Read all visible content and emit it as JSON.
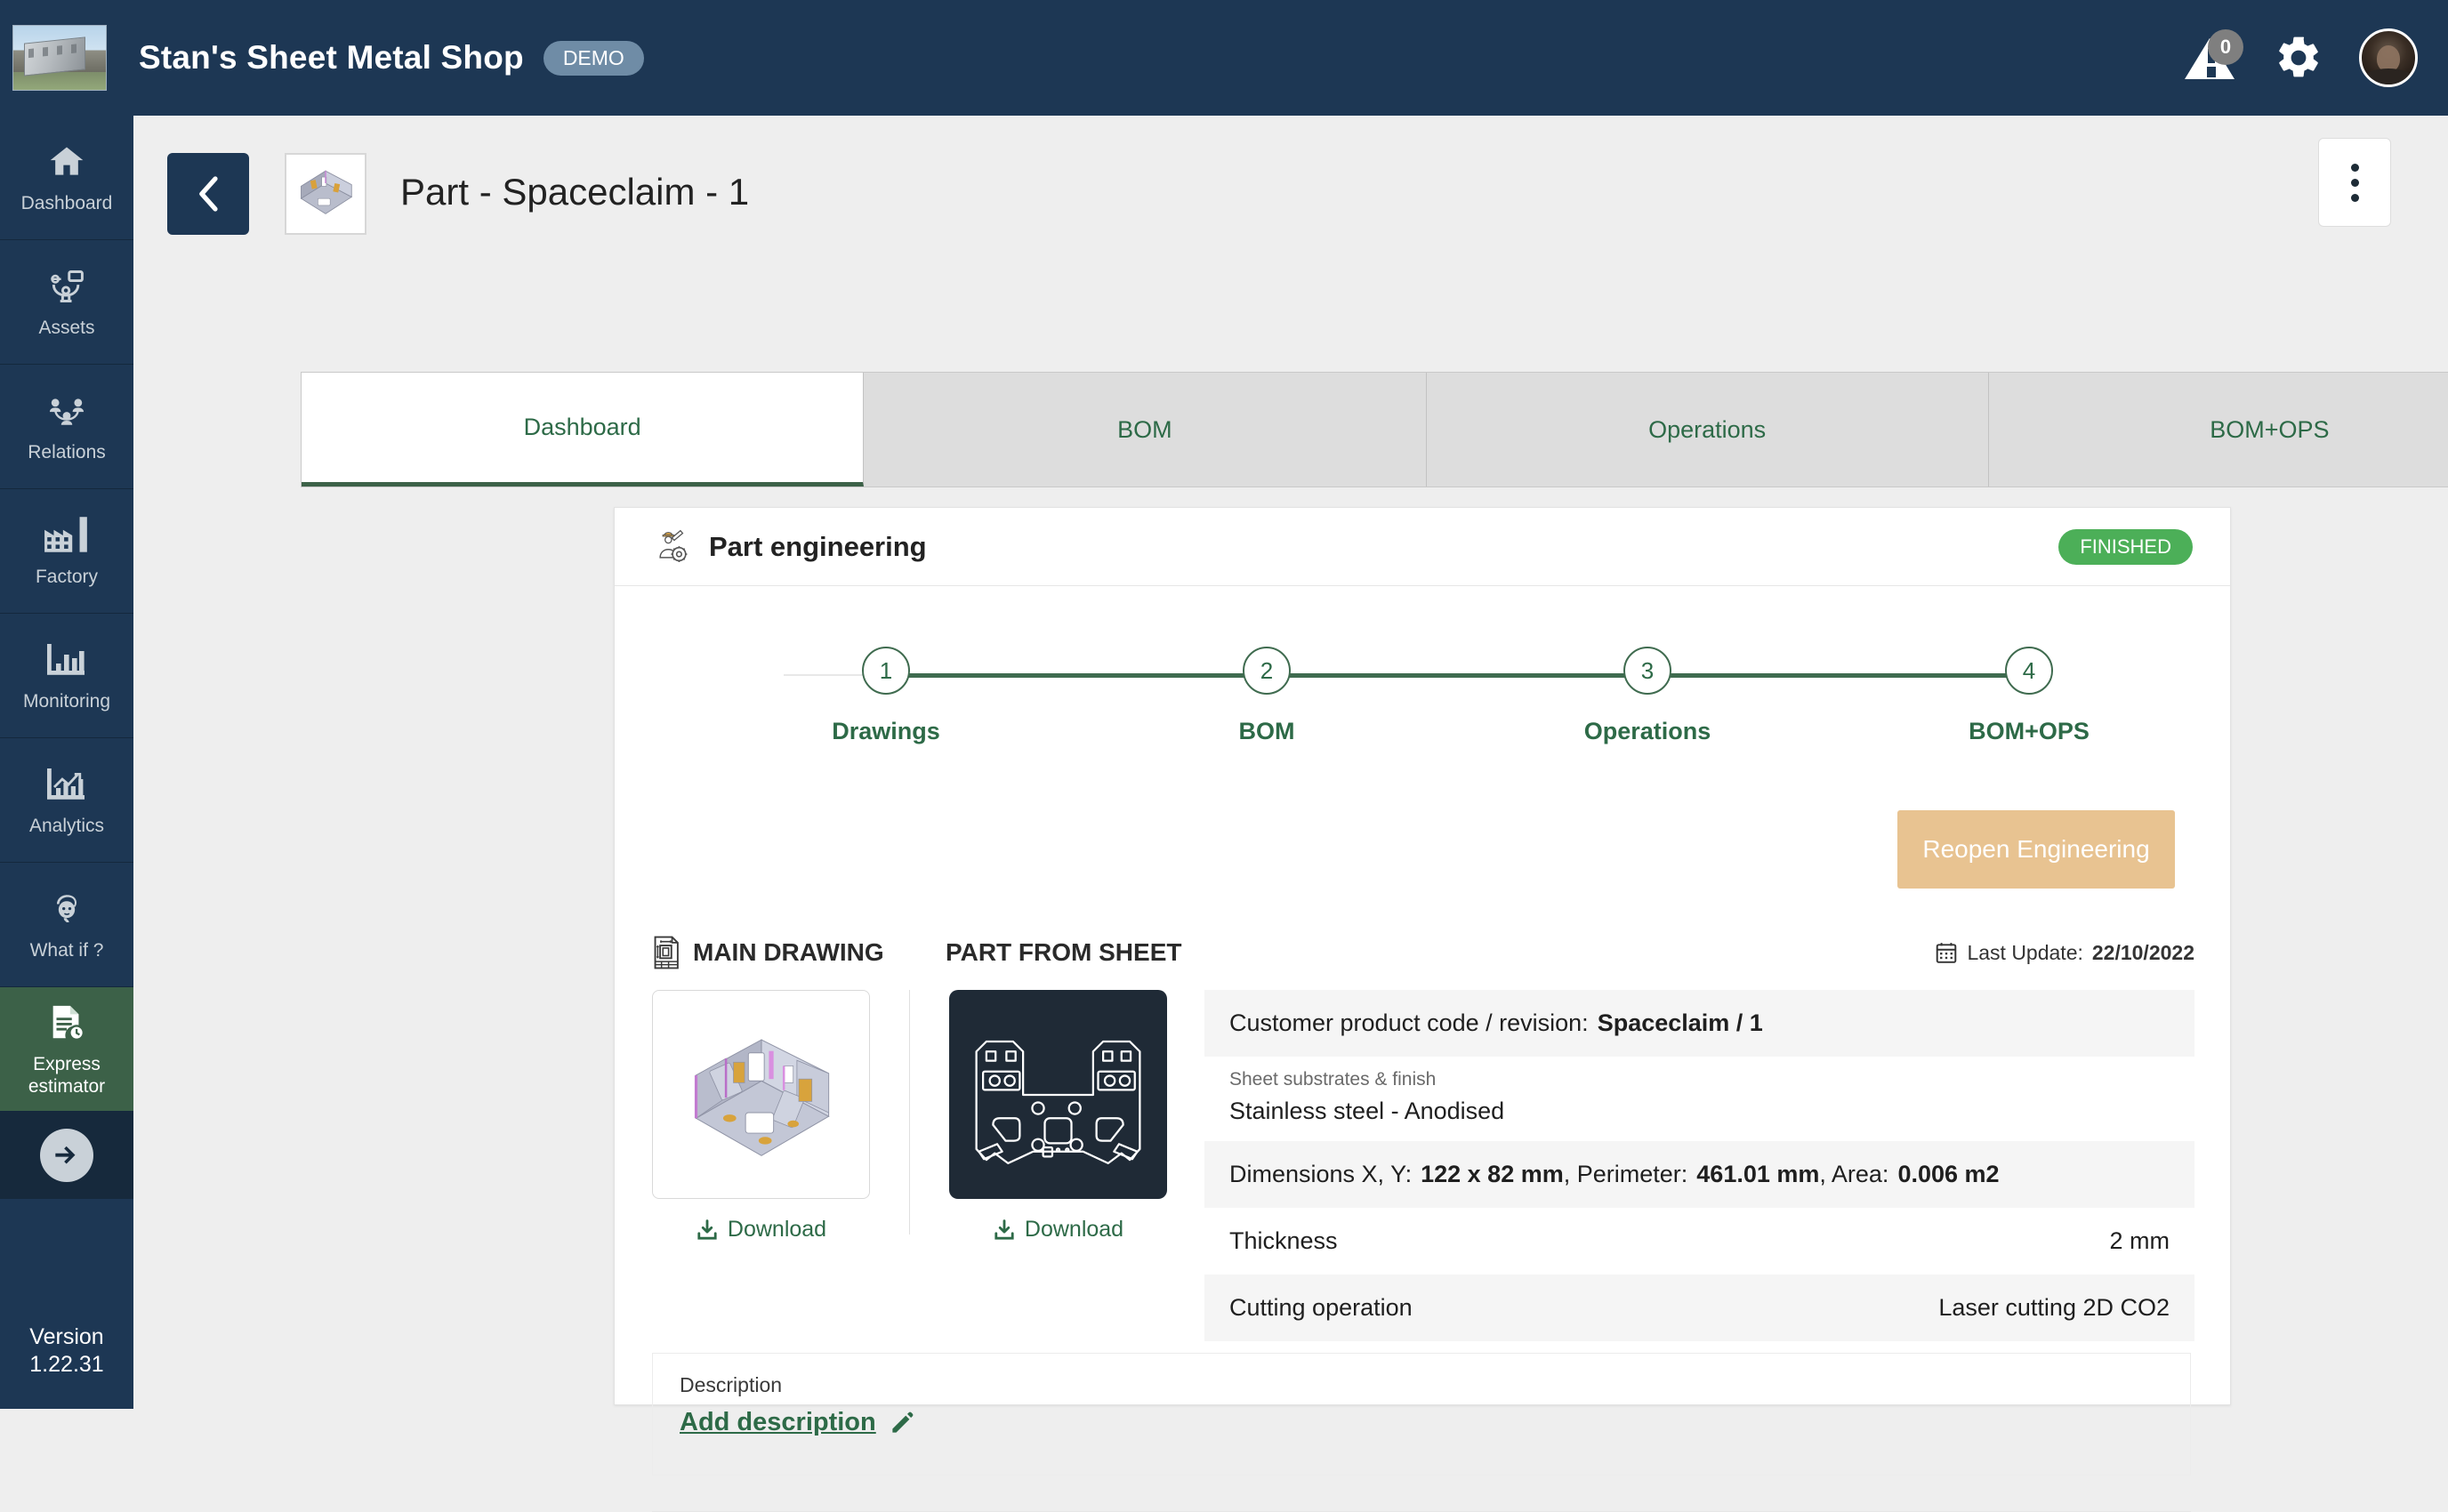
{
  "topbar": {
    "app_title": "Stan's Sheet Metal Shop",
    "demo_badge": "DEMO",
    "notification_count": "0",
    "logo_name": "company-building-logo",
    "icons": [
      "warning-bell-icon",
      "gear-icon",
      "user-avatar"
    ]
  },
  "sidebar": {
    "items": [
      {
        "label": "Dashboard",
        "icon": "home-icon",
        "active": false
      },
      {
        "label": "Assets",
        "icon": "assets-network-icon",
        "active": false
      },
      {
        "label": "Relations",
        "icon": "relations-people-icon",
        "active": false
      },
      {
        "label": "Factory",
        "icon": "factory-icon",
        "active": false
      },
      {
        "label": "Monitoring",
        "icon": "bar-chart-icon",
        "active": false
      },
      {
        "label": "Analytics",
        "icon": "trend-chart-icon",
        "active": false
      },
      {
        "label": "What if ?",
        "icon": "thinking-face-icon",
        "active": false
      },
      {
        "label": "Express estimator",
        "icon": "document-clock-icon",
        "active": true
      }
    ],
    "collapse_icon": "arrow-right-circle-icon",
    "version_label": "Version",
    "version_number": "1.22.31"
  },
  "page": {
    "back_icon": "chevron-left-icon",
    "thumbnail_name": "part-3d-thumbnail",
    "title": "Part - Spaceclaim - 1",
    "kebab_icon": "more-vertical-icon"
  },
  "tabs": [
    {
      "label": "Dashboard",
      "active": true
    },
    {
      "label": "BOM",
      "active": false
    },
    {
      "label": "Operations",
      "active": false
    },
    {
      "label": "BOM+OPS",
      "active": false
    }
  ],
  "card": {
    "header_icon": "engineer-gear-icon",
    "title": "Part engineering",
    "status": "FINISHED",
    "status_color": "#4caf58"
  },
  "stepper": {
    "steps": [
      {
        "number": "1",
        "label": "Drawings"
      },
      {
        "number": "2",
        "label": "BOM"
      },
      {
        "number": "3",
        "label": "Operations"
      },
      {
        "number": "4",
        "label": "BOM+OPS"
      }
    ],
    "line_color": "#3f6b4f"
  },
  "actions": {
    "reopen_label": "Reopen Engineering",
    "reopen_color": "#e8c391"
  },
  "details": {
    "main_drawing_heading": "MAIN DRAWING",
    "main_drawing_icon": "technical-drawing-icon",
    "part_from_sheet_heading": "PART FROM SHEET",
    "last_update_icon": "calendar-icon",
    "last_update_label": "Last Update:",
    "last_update_value": "22/10/2022",
    "download_label": "Download",
    "download_icon": "download-icon",
    "specs": [
      {
        "kind": "inline",
        "label": "Customer product code / revision:",
        "value": "Spaceclaim / 1",
        "alt": true
      },
      {
        "kind": "stacked",
        "sub": "Sheet substrates & finish",
        "label": "Stainless steel - Anodised",
        "alt": false
      },
      {
        "kind": "dimensions",
        "prefix": "Dimensions X, Y:",
        "dim_value": "122 x 82 mm",
        "perimeter_label": ", Perimeter:",
        "perimeter_value": "461.01 mm",
        "area_label": ", Area:",
        "area_value": "0.006 m2",
        "alt": true
      },
      {
        "kind": "pair",
        "label": "Thickness",
        "value": "2 mm",
        "alt": false
      },
      {
        "kind": "pair",
        "label": "Cutting operation",
        "value": "Laser cutting 2D CO2",
        "alt": true
      }
    ]
  },
  "description": {
    "label": "Description",
    "link_text": "Add description",
    "edit_icon": "pencil-icon"
  }
}
